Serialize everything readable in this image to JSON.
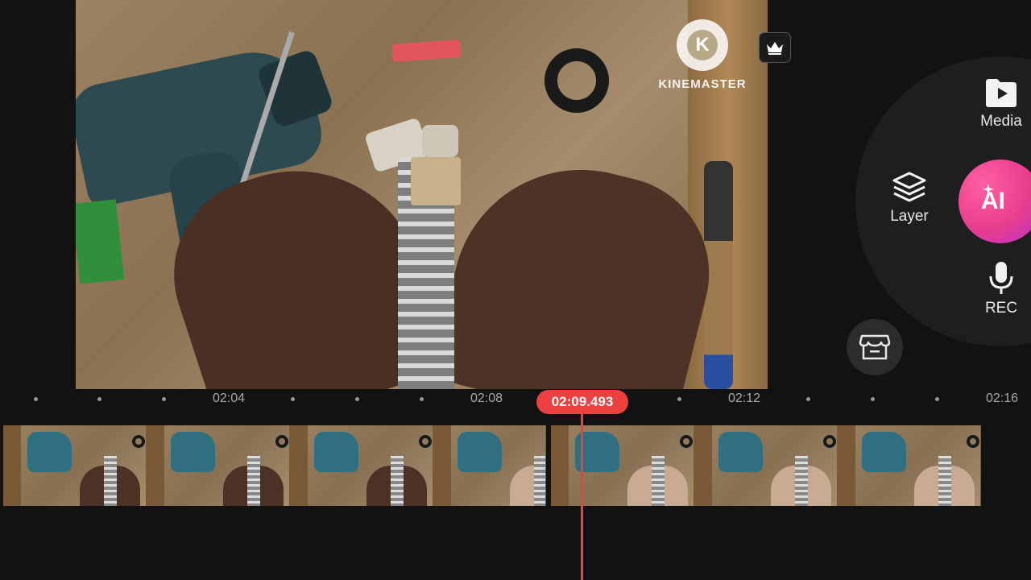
{
  "preview": {
    "watermark_letter": "K",
    "watermark_text": "KINEMASTER"
  },
  "side_panel": {
    "media_label": "Media",
    "layer_label": "Layer",
    "ai_label": "AI",
    "rec_label": "REC"
  },
  "timeline": {
    "current_time": "02:09.493",
    "tick_labels": [
      "02:04",
      "02:08",
      "02:12",
      "02:16"
    ],
    "clips": [
      {
        "thumbnails": 4,
        "style": "dark"
      },
      {
        "thumbnails": 3,
        "style": "light"
      }
    ]
  },
  "colors": {
    "playhead": "#ec3f3f",
    "ai_button": "#e83d8d",
    "background": "#121212"
  },
  "icons": [
    "crown-icon",
    "media-folder-icon",
    "layer-stack-icon",
    "ai-sparkle-icon",
    "microphone-icon",
    "asset-store-icon"
  ]
}
